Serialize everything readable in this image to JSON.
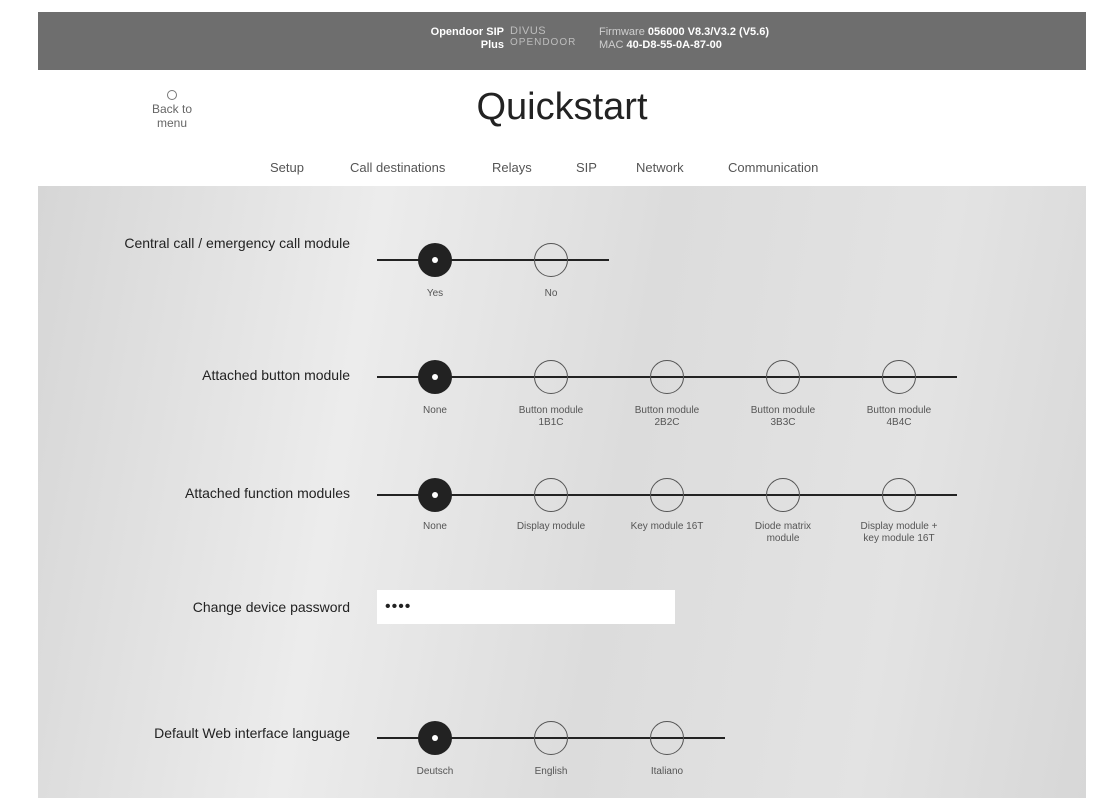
{
  "topbar": {
    "product_line1": "Opendoor SIP",
    "product_line2": "Plus",
    "brand_line1": "DIVUS",
    "brand_line2": "OPENDOOR",
    "firmware_label": "Firmware",
    "firmware_value": "056000 V8.3/V3.2 (V5.6)",
    "mac_label": "MAC",
    "mac_value": "40-D8-55-0A-87-00"
  },
  "header": {
    "back_label": "Back to menu",
    "title": "Quickstart"
  },
  "tabs": [
    {
      "label": "Setup",
      "active": true
    },
    {
      "label": "Call destinations",
      "active": false
    },
    {
      "label": "Relays",
      "active": false
    },
    {
      "label": "SIP",
      "active": false
    },
    {
      "label": "Network",
      "active": false
    },
    {
      "label": "Communication",
      "active": false
    }
  ],
  "settings": {
    "central_call": {
      "label": "Central call / emergency call module",
      "options": [
        "Yes",
        "No"
      ],
      "selected": 0
    },
    "button_module": {
      "label": "Attached button module",
      "options": [
        "None",
        "Button module 1B1C",
        "Button module 2B2C",
        "Button module 3B3C",
        "Button module 4B4C"
      ],
      "selected": 0
    },
    "function_modules": {
      "label": "Attached function modules",
      "options": [
        "None",
        "Display module",
        "Key module 16T",
        "Diode matrix module",
        "Display module + key module 16T"
      ],
      "selected": 0
    },
    "password": {
      "label": "Change device password",
      "value": "••••"
    },
    "language": {
      "label": "Default Web interface language",
      "options": [
        "Deutsch",
        "English",
        "Italiano"
      ],
      "selected": 0
    }
  },
  "colors": {
    "topbar": "#6e6e6e",
    "selected_node": "#222222",
    "content_bg": "#e0e0e0"
  }
}
